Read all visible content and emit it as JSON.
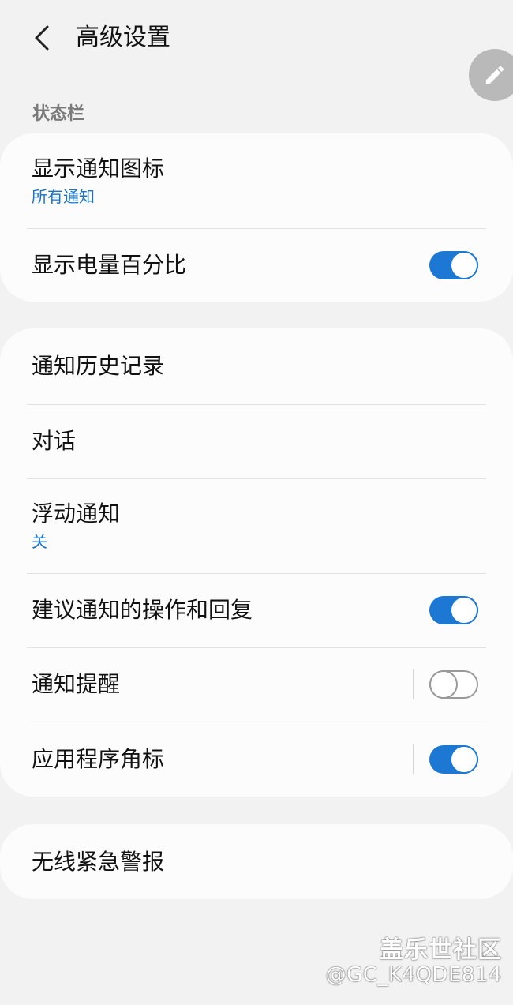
{
  "header": {
    "title": "高级设置",
    "back_icon": "chevron-left-icon",
    "edit_icon": "pencil-icon"
  },
  "status_bar_section": {
    "label": "状态栏",
    "items": [
      {
        "title": "显示通知图标",
        "subtitle": "所有通知"
      },
      {
        "title": "显示电量百分比",
        "toggle": true
      }
    ]
  },
  "notifications_section": {
    "items": [
      {
        "title": "通知历史记录"
      },
      {
        "title": "对话"
      },
      {
        "title": "浮动通知",
        "subtitle": "关"
      },
      {
        "title": "建议通知的操作和回复",
        "toggle": true
      },
      {
        "title": "通知提醒",
        "toggle": false
      },
      {
        "title": "应用程序角标",
        "toggle": true
      }
    ]
  },
  "emergency_section": {
    "items": [
      {
        "title": "无线紧急警报"
      }
    ]
  },
  "watermark": {
    "site": "盖乐世社区",
    "user": "@GC_K4QDE814"
  },
  "colors": {
    "accent": "#1d78d4",
    "background": "#f2f2f2",
    "card": "#fcfcfc",
    "subtitle": "#1a73c8"
  }
}
